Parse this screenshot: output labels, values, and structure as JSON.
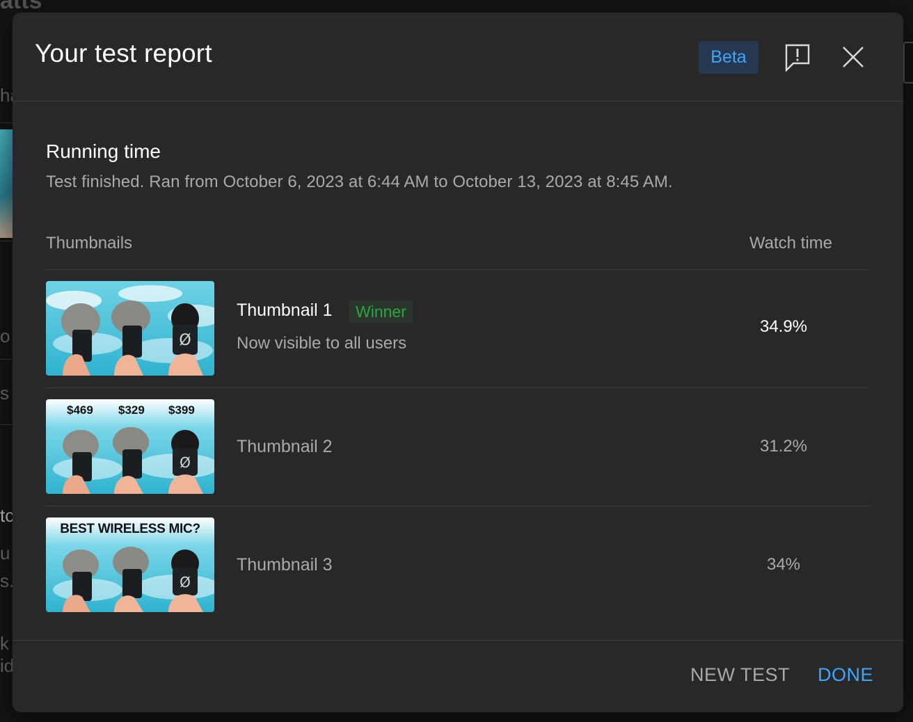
{
  "dialog": {
    "title": "Your test report",
    "badge": "Beta",
    "feedback_icon": "feedback-icon",
    "close_icon": "close-icon"
  },
  "running": {
    "title": "Running time",
    "subtitle": "Test finished. Ran from October 6, 2023 at 6:44 AM to October 13, 2023 at 8:45 AM."
  },
  "table": {
    "col_thumbnails": "Thumbnails",
    "col_watch": "Watch time",
    "rows": [
      {
        "name": "Thumbnail 1",
        "badge": "Winner",
        "note": "Now visible to all users",
        "watch": "34.9%"
      },
      {
        "name": "Thumbnail 2",
        "watch": "31.2%",
        "prices": [
          "$469",
          "$329",
          "$399"
        ]
      },
      {
        "name": "Thumbnail 3",
        "watch": "34%",
        "headline": "BEST WIRELESS MIC?"
      }
    ]
  },
  "footer": {
    "new_test": "NEW TEST",
    "done": "DONE"
  },
  "colors": {
    "accent": "#3ea6ff",
    "winner": "#2ba640",
    "surface": "#282828"
  }
}
